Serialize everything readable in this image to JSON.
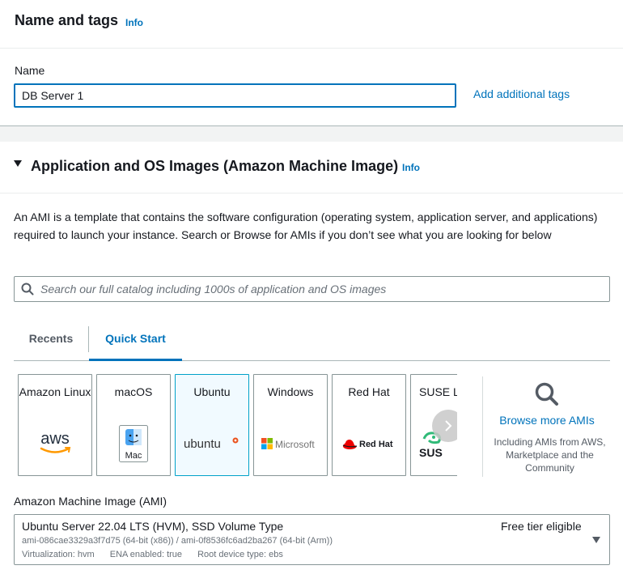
{
  "name_and_tags": {
    "title": "Name and tags",
    "info": "Info",
    "name_label": "Name",
    "name_value": "DB Server 1",
    "add_tags": "Add additional tags"
  },
  "ami_section": {
    "title": "Application and OS Images (Amazon Machine Image)",
    "info": "Info",
    "description": "An AMI is a template that contains the software configuration (operating system, application server, and applications) required to launch your instance. Search or Browse for AMIs if you don’t see what you are looking for below",
    "search_placeholder": "Search our full catalog including 1000s of application and OS images",
    "tabs": [
      {
        "label": "Recents",
        "active": false
      },
      {
        "label": "Quick Start",
        "active": true
      }
    ],
    "os_cards": [
      {
        "label": "Amazon Linux",
        "logo_text": "aws",
        "icon": "aws-logo-icon",
        "selected": false
      },
      {
        "label": "macOS",
        "logo_text": "Mac",
        "icon": "mac-finder-icon",
        "selected": false
      },
      {
        "label": "Ubuntu",
        "logo_text": "ubuntu",
        "icon": "ubuntu-logo-icon",
        "selected": true
      },
      {
        "label": "Windows",
        "logo_text": "Microsoft",
        "icon": "microsoft-logo-icon",
        "selected": false
      },
      {
        "label": "Red Hat",
        "logo_text": "Red Hat",
        "icon": "redhat-logo-icon",
        "selected": false
      },
      {
        "label": "SUSE Li",
        "logo_text": "SUS",
        "icon": "suse-logo-icon",
        "selected": false
      }
    ],
    "browse_more": {
      "link": "Browse more AMIs",
      "subtext": "Including AMIs from AWS, Marketplace and the Community"
    },
    "ami_label": "Amazon Machine Image (AMI)",
    "selected_ami": {
      "title": "Ubuntu Server 22.04 LTS (HVM), SSD Volume Type",
      "badge": "Free tier eligible",
      "ids": "ami-086cae3329a3f7d75 (64-bit (x86)) / ami-0f8536fc6ad2ba267 (64-bit (Arm))",
      "virtualization": "Virtualization: hvm",
      "ena": "ENA enabled: true",
      "root_device": "Root device type: ebs"
    }
  },
  "colors": {
    "link": "#0073bb",
    "text": "#16191f",
    "border": "#879596",
    "selected_bg": "#f1faff",
    "selected_border": "#00a1c9"
  }
}
